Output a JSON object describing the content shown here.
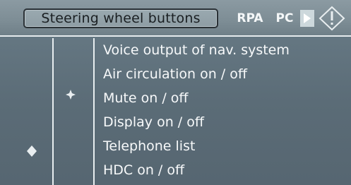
{
  "header": {
    "active_tab": "Steering wheel buttons",
    "tabs": [
      {
        "label": "RPA"
      },
      {
        "label": "PC"
      }
    ],
    "next_icon": "play-triangle-icon",
    "info_icon": "info-diamond-icon"
  },
  "list": {
    "items": [
      {
        "label": "Voice output of nav. system"
      },
      {
        "label": "Air circulation on / off"
      },
      {
        "label": "Mute on / off"
      },
      {
        "label": "Display on / off"
      },
      {
        "label": "Telephone list"
      },
      {
        "label": "HDC on / off"
      }
    ],
    "selected_index": 1
  },
  "icons": {
    "selection_marker": "selection-marker-icon",
    "scroll_marker": "diamond-scroll-icon"
  }
}
